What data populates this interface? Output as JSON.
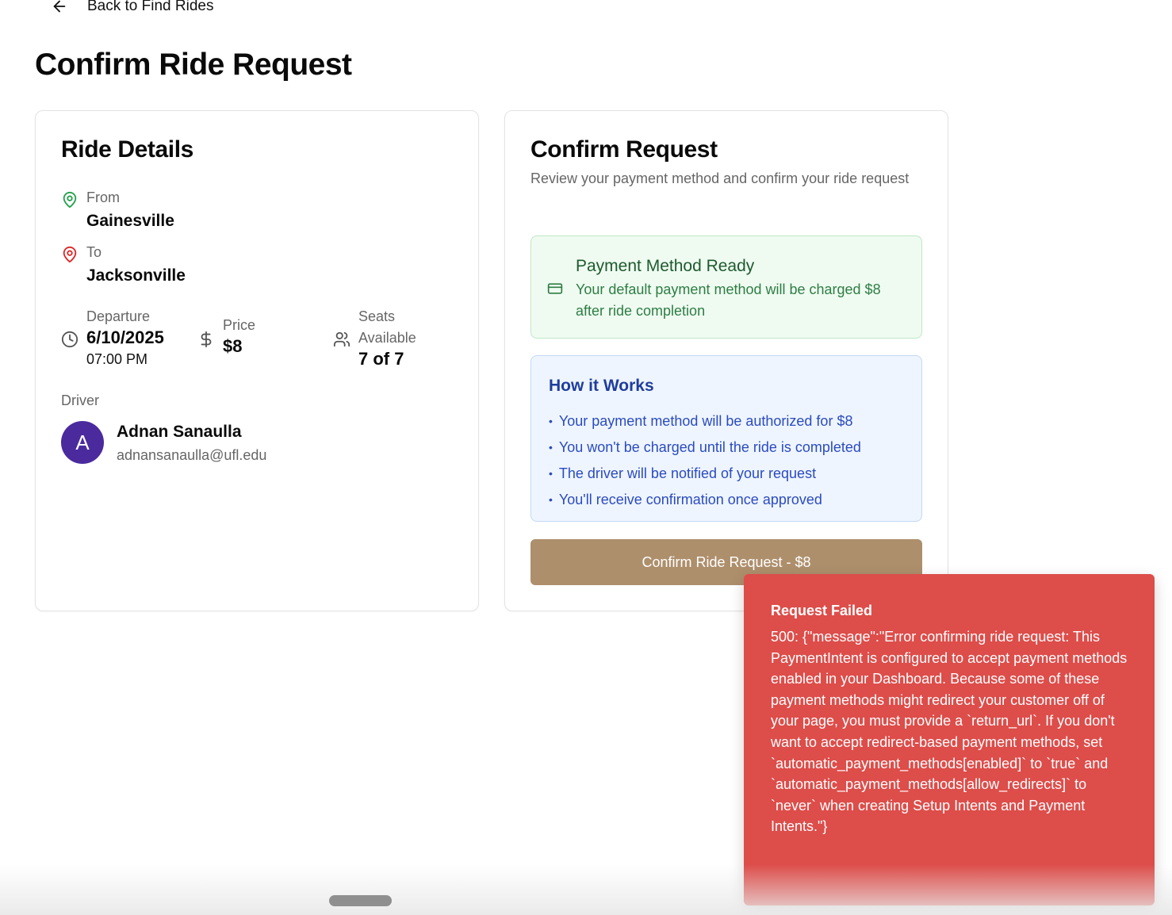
{
  "nav": {
    "back_label": "Back to Find Rides"
  },
  "page": {
    "title": "Confirm Ride Request"
  },
  "ride_details": {
    "title": "Ride Details",
    "from": {
      "label": "From",
      "value": "Gainesville",
      "icon": "map-pin-icon",
      "color": "#22a04b"
    },
    "to": {
      "label": "To",
      "value": "Jacksonville",
      "icon": "map-pin-icon",
      "color": "#dc2626"
    },
    "departure": {
      "label": "Departure",
      "date": "6/10/2025",
      "time": "07:00 PM",
      "icon": "clock-icon"
    },
    "price": {
      "label": "Price",
      "value": "$8",
      "icon": "dollar-icon"
    },
    "seats": {
      "label_line1": "Seats",
      "label_line2": "Available",
      "value": "7 of 7",
      "icon": "users-icon"
    },
    "driver": {
      "label": "Driver",
      "initial": "A",
      "name": "Adnan Sanaulla",
      "email": "adnansanaulla@ufl.edu",
      "avatar_color": "#4b2a9e"
    }
  },
  "confirm": {
    "title": "Confirm Request",
    "subtitle": "Review your payment method and confirm your ride request",
    "payment": {
      "icon": "credit-card-icon",
      "title": "Payment Method Ready",
      "description": "Your default payment method will be charged $8 after ride completion"
    },
    "how_it_works": {
      "title": "How it Works",
      "items": [
        "Your payment method will be authorized for $8",
        "You won't be charged until the ride is completed",
        "The driver will be notified of your request",
        "You'll receive confirmation once approved"
      ]
    },
    "button_label": "Confirm Ride Request - $8",
    "button_color": "#ae8f6c"
  },
  "toast": {
    "title": "Request Failed",
    "message": "500: {\"message\":\"Error confirming ride request: This PaymentIntent is configured to accept payment methods enabled in your Dashboard. Because some of these payment methods might redirect your customer off of your page, you must provide a `return_url`. If you don't want to accept redirect-based payment methods, set `automatic_payment_methods[enabled]` to `true` and `automatic_payment_methods[allow_redirects]` to `never` when creating Setup Intents and Payment Intents.\"}",
    "color": "#dd4d4a"
  }
}
